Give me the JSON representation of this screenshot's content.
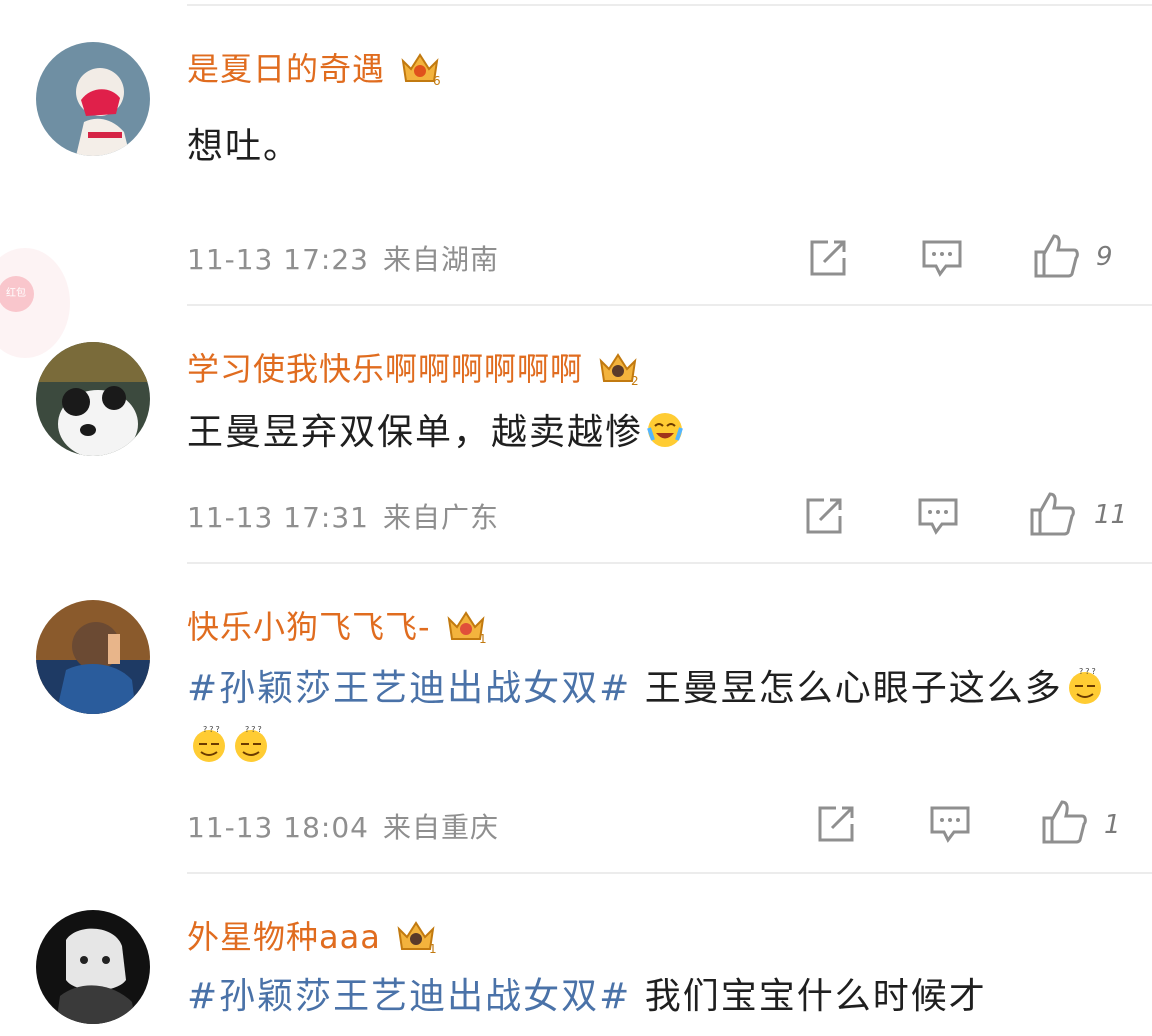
{
  "floating_badge": {
    "label": "红包"
  },
  "comments": [
    {
      "username": "是夏日的奇遇",
      "level": "6",
      "text": "想吐。",
      "time": "11-13 17:23",
      "location": "来自湖南",
      "likes": "9"
    },
    {
      "username": "学习使我快乐啊啊啊啊啊啊",
      "level": "2",
      "text": "王曼昱弃双保单，越卖越惨",
      "emoji": "crying-laughing-emoji",
      "time": "11-13 17:31",
      "location": "来自广东",
      "likes": "11"
    },
    {
      "username": "快乐小狗飞飞飞-",
      "level": "1",
      "hashtag": "#孙颖莎王艺迪出战女双#",
      "text": " 王曼昱怎么心眼子这么多",
      "emoji": "confused-emoji",
      "time": "11-13 18:04",
      "location": "来自重庆",
      "likes": "1"
    },
    {
      "username": "外星物种aaa",
      "level": "1",
      "hashtag": "#孙颖莎王艺迪出战女双#",
      "text": " 我们宝宝什么时候才"
    }
  ],
  "colors": {
    "username": "#e06c1f",
    "hashtag": "#4a72a8",
    "meta": "#8f8f8f",
    "divider": "#ececec"
  },
  "icons": {
    "repost": "share-icon",
    "comment": "comment-icon",
    "like": "thumbs-up-icon",
    "level": "crown-badge-icon"
  }
}
